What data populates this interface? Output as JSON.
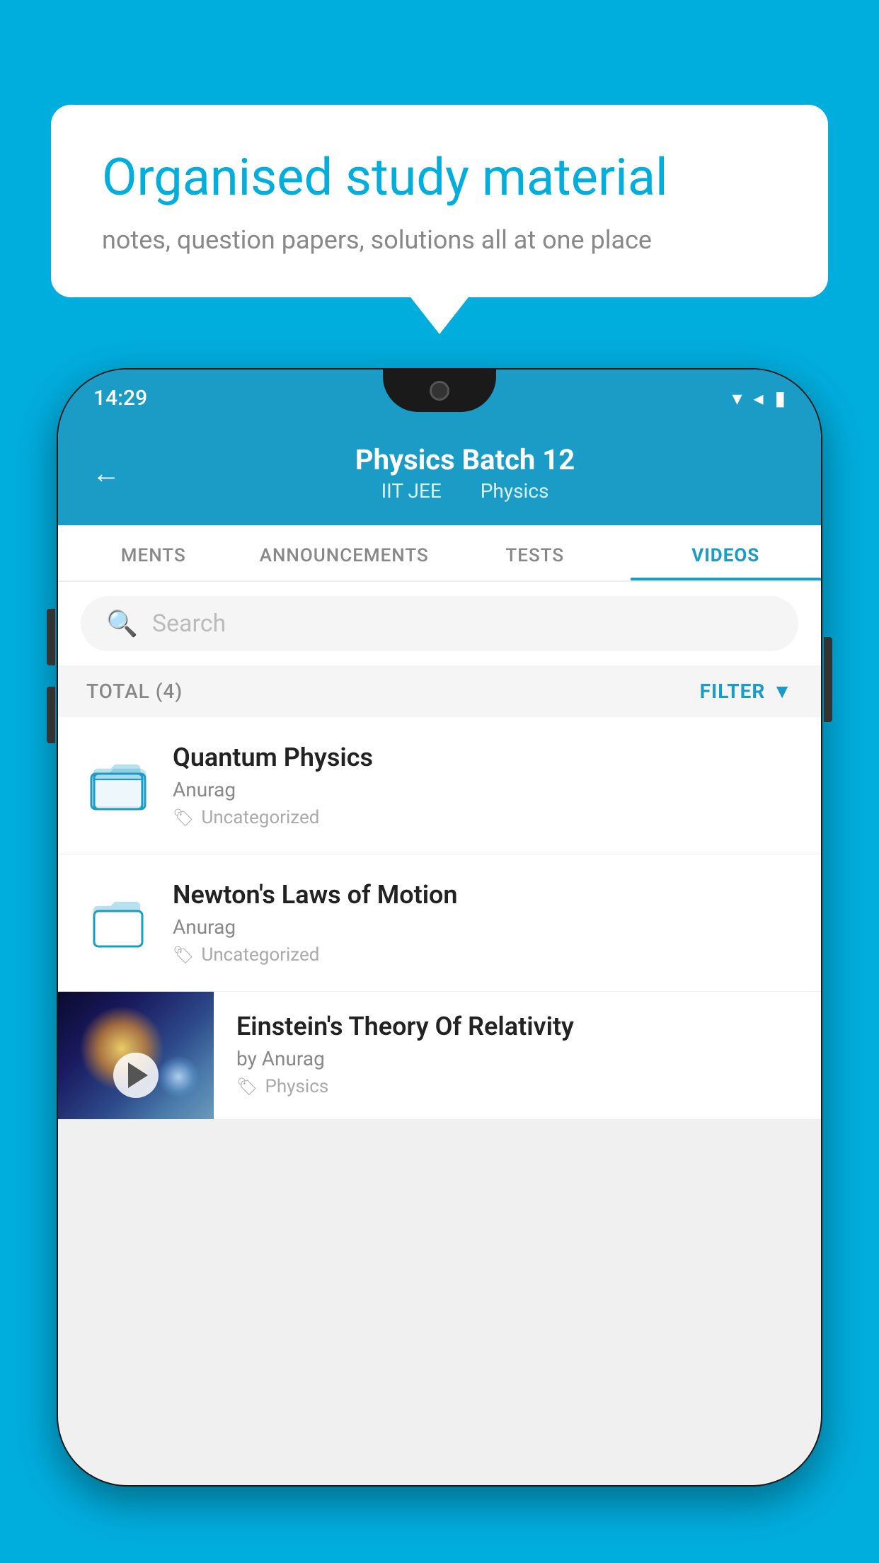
{
  "background_color": "#00AEDE",
  "speech_bubble": {
    "title": "Organised study material",
    "subtitle": "notes, question papers, solutions all at one place"
  },
  "phone": {
    "status_bar": {
      "time": "14:29",
      "icons": [
        "wifi",
        "signal",
        "battery"
      ]
    },
    "header": {
      "title": "Physics Batch 12",
      "subtitle_parts": [
        "IIT JEE",
        "Physics"
      ],
      "back_label": "←"
    },
    "tabs": [
      {
        "label": "MENTS",
        "active": false
      },
      {
        "label": "ANNOUNCEMENTS",
        "active": false
      },
      {
        "label": "TESTS",
        "active": false
      },
      {
        "label": "VIDEOS",
        "active": true
      }
    ],
    "search": {
      "placeholder": "Search"
    },
    "filter_bar": {
      "total_label": "TOTAL (4)",
      "filter_label": "FILTER"
    },
    "videos": [
      {
        "id": 1,
        "title": "Quantum Physics",
        "author": "Anurag",
        "tag": "Uncategorized",
        "has_thumbnail": false
      },
      {
        "id": 2,
        "title": "Newton's Laws of Motion",
        "author": "Anurag",
        "tag": "Uncategorized",
        "has_thumbnail": false
      },
      {
        "id": 3,
        "title": "Einstein's Theory Of Relativity",
        "author": "by Anurag",
        "tag": "Physics",
        "has_thumbnail": true
      }
    ]
  }
}
